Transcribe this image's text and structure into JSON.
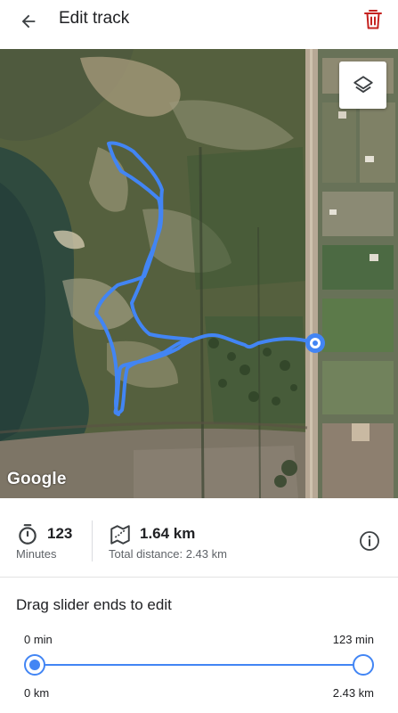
{
  "appbar": {
    "title": "Edit track",
    "back_icon": "arrow-back-icon",
    "delete_icon": "trash-icon",
    "delete_color": "#c5221f"
  },
  "map": {
    "attribution": "Google",
    "layers_icon": "layers-icon",
    "route_color": "#4285f4"
  },
  "stats": {
    "time_value": "123",
    "time_label": "Minutes",
    "time_icon": "stopwatch-icon",
    "distance_value": "1.64 km",
    "distance_label": "Total distance: 2.43 km",
    "distance_icon": "map-route-icon",
    "info_icon": "info-icon"
  },
  "editor": {
    "heading": "Drag slider ends to edit",
    "start_time": "0 min",
    "end_time": "123 min",
    "start_distance": "0 km",
    "end_distance": "2.43 km",
    "accent": "#4285f4"
  }
}
